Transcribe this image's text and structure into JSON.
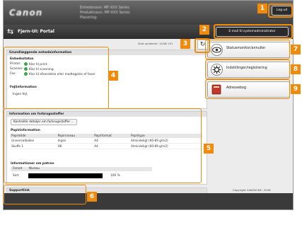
{
  "header": {
    "logo": "Canon",
    "blur_lines": [
      "Enhedsnavn:  MF-XXX Series",
      "Produktnavn:  MF-XXX Series",
      "Placering:"
    ],
    "logout_label": "Log ud"
  },
  "portal": {
    "title": "Fjern-UI: Portal",
    "admin_label": "E-mail til systemadministrator"
  },
  "updated_text": "Sidst opdateret: 15/06/ 201",
  "device_panel": {
    "title": "Grundlæggende enhedsinformation",
    "status_heading": "Enhedsstatus",
    "rows": [
      {
        "label": "Printer:",
        "value": "Klar til print."
      },
      {
        "label": "Scanner:",
        "value": "Klar til scanning."
      },
      {
        "label": "Fax:",
        "value": "Klar til afsendelse eller modtagelse af faxer"
      }
    ],
    "error_heading": "Fejlinformation",
    "error_value": "Ingen fejl."
  },
  "consumables_panel": {
    "title": "Information om forbrugsstoffer",
    "details_button": "Kontrollér detaljer om forbrugsstoffer ...",
    "paper_heading": "Papirinformation",
    "paper_columns": [
      "Papirkilde",
      "Papirniveau",
      "Papirformat",
      "Papirtype"
    ],
    "paper_rows": [
      [
        "Universalbakke",
        "Ingen",
        "A4",
        "Almindeligt (60-89 g/m2)"
      ],
      [
        "Skuffe 1",
        "OK",
        "A4",
        "Almindeligt (60-89 g/m2)"
      ]
    ],
    "cartridge_heading": "Informationer om patron",
    "cartridge_columns": [
      "Farvet",
      "Niveau"
    ],
    "cartridge_row": {
      "color": "Sort",
      "level_percent": 100,
      "level_text": "100 %"
    }
  },
  "support_panel": {
    "title": "Supportlink",
    "value": "Supportlink"
  },
  "nav": {
    "status_monitor": "Statusmonitor/annuller",
    "settings": "Indstillinger/registrering",
    "address_book": "Adressebog"
  },
  "copyright": "Copyright CANON INC. 2016",
  "callouts": [
    "1",
    "2",
    "3",
    "4",
    "5",
    "6",
    "7",
    "8",
    "9"
  ],
  "colors": {
    "callout": "#f08a0b",
    "status_ok": "#3ea64a",
    "header": "#3e3e3e"
  }
}
